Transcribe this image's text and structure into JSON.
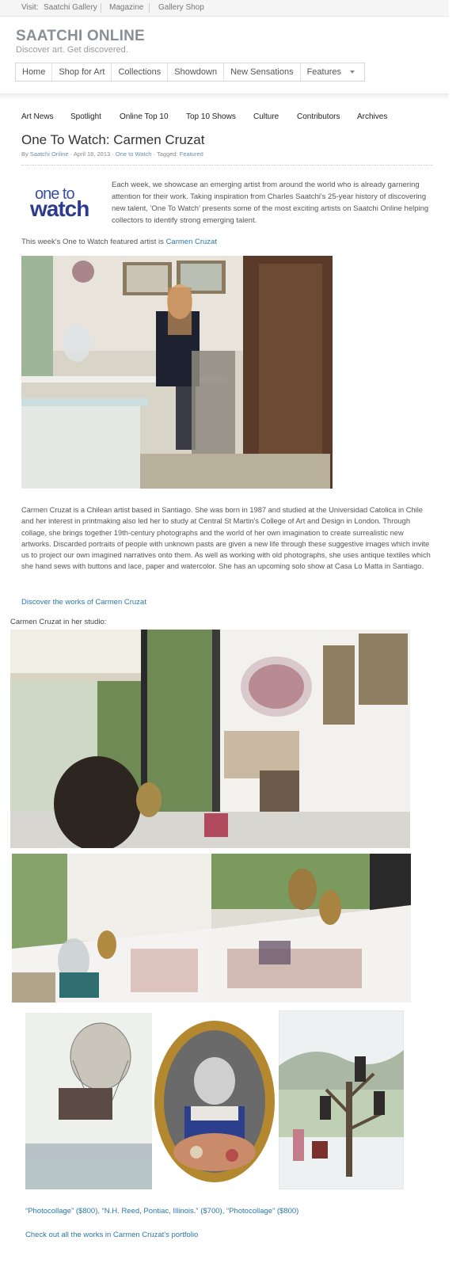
{
  "topbar": {
    "visit_label": "Visit:",
    "links": [
      "Saatchi Gallery",
      "Magazine",
      "Gallery Shop"
    ]
  },
  "brand": {
    "logo": "SAATCHI ONLINE",
    "tagline": "Discover art. Get discovered."
  },
  "main_nav": [
    "Home",
    "Shop for Art",
    "Collections",
    "Showdown",
    "New Sensations",
    "Features"
  ],
  "sub_nav": [
    "Art News",
    "Spotlight",
    "Online Top 10",
    "Top 10 Shows",
    "Culture",
    "Contributors",
    "Archives"
  ],
  "article": {
    "title": "One To Watch: Carmen Cruzat",
    "byline_by": "By",
    "author": "Saatchi Online",
    "date": "April 18, 2013",
    "category": "One to Watch",
    "tagged_label": "Tagged:",
    "tag": "Featured",
    "logo_one": "one to",
    "logo_watch": "watch",
    "intro": "Each week, we showcase an emerging artist from around the world who is already garnering attention for their work. Taking inspiration from Charles Saatchi's 25-year history of discovering new talent, 'One To Watch' presents some of the most exciting artists on Saatchi Online helping collectors to identify strong emerging talent.",
    "featured_prefix": "This week's One to Watch featured artist is",
    "featured_artist": "Carmen Cruzat",
    "bio": "Carmen Cruzat is a Chilean artist based in Santiago. She was born in 1987 and studied at the Universidad Catolica in Chile and her interest in printmaking also led her to study at Central St Martin's College of Art and Design in London. Through collage, she brings together 19th-century photographs and the world of her own imagination to create surrealistic new artworks. Discarded portraits of people with unknown pasts are given a new life through these suggestive images which invite us to project our own imagined narratives onto them. As well as working with old photographs, she uses antique textiles which she hand sews with buttons and lace, paper and watercolor. She has an upcoming solo show at Casa Lo Matta in Santiago.",
    "discover_link": "Discover the works of Carmen Cruzat",
    "studio_caption": "Carmen Cruzat in her studio:",
    "artworks_caption": "“Photocollage” ($800), “N.H. Reed, Pontiac, Illinois.” ($700), “Photocollage” ($800)",
    "portfolio_link": "Check out all the works in Carmen Cruzat's portfolio"
  },
  "colors": {
    "link": "#2b77a8",
    "logo_grey": "#8a8f96",
    "otw_blue": "#2d3b8f"
  }
}
